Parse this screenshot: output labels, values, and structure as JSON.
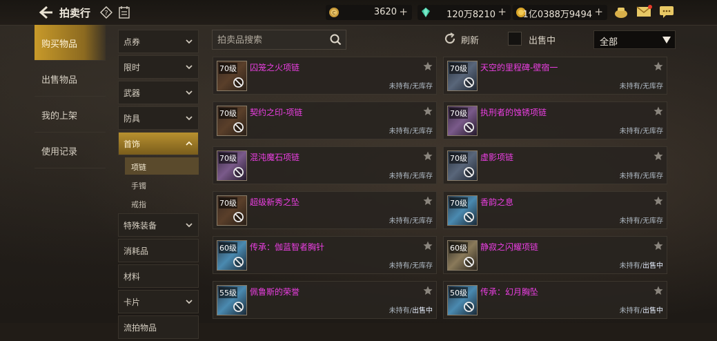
{
  "header": {
    "title": "拍卖行",
    "currencies": [
      {
        "icon": "gold-coin-icon",
        "value": "3620"
      },
      {
        "icon": "green-gem-icon",
        "value": "120万8210"
      },
      {
        "icon": "coin-icon",
        "value": "1亿0388万9494"
      }
    ],
    "plus": "+"
  },
  "nav": {
    "items": [
      {
        "label": "购买物品",
        "active": true
      },
      {
        "label": "出售物品",
        "active": false
      },
      {
        "label": "我的上架",
        "active": false
      },
      {
        "label": "使用记录",
        "active": false
      }
    ]
  },
  "categories": {
    "items": [
      {
        "label": "点券"
      },
      {
        "label": "限时"
      },
      {
        "label": "武器"
      },
      {
        "label": "防具"
      },
      {
        "label": "首饰"
      },
      {
        "label": "特殊装备"
      },
      {
        "label": "消耗品"
      },
      {
        "label": "材料"
      },
      {
        "label": "卡片"
      },
      {
        "label": "流拍物品"
      }
    ],
    "subitems": [
      {
        "label": "项链"
      },
      {
        "label": "手镯"
      },
      {
        "label": "戒指"
      }
    ]
  },
  "toolbar": {
    "search_placeholder": "拍卖品搜索",
    "refresh_label": "刷新",
    "on_sale_label": "出售中",
    "filter_value": "全部"
  },
  "items": [
    {
      "level": "70级",
      "name": "囚笼之火项链",
      "own": "未持有",
      "sep": "/",
      "stock": "无库存"
    },
    {
      "level": "70级",
      "name": "天空的里程碑-壁宿一",
      "own": "未持有",
      "sep": "/",
      "stock": "无库存"
    },
    {
      "level": "70级",
      "name": "契约之印-项链",
      "own": "未持有",
      "sep": "/",
      "stock": "无库存"
    },
    {
      "level": "70级",
      "name": "执刑者的蚀锈项链",
      "own": "未持有",
      "sep": "/",
      "stock": "无库存"
    },
    {
      "level": "70级",
      "name": "混沌魔石项链",
      "own": "未持有",
      "sep": "/",
      "stock": "无库存"
    },
    {
      "level": "70级",
      "name": "虚影项链",
      "own": "未持有",
      "sep": "/",
      "stock": "无库存"
    },
    {
      "level": "70级",
      "name": "超级新秀之坠",
      "own": "未持有",
      "sep": "/",
      "stock": "无库存"
    },
    {
      "level": "70级",
      "name": "香韵之息",
      "own": "未持有",
      "sep": "/",
      "stock": "无库存"
    },
    {
      "level": "60级",
      "name": "传承：伽蓝智者胸针",
      "own": "未持有",
      "sep": "/",
      "stock": "无库存"
    },
    {
      "level": "60级",
      "name": "静寂之闪耀项链",
      "own": "未持有",
      "sep": "/",
      "stock": "出售中"
    },
    {
      "level": "55级",
      "name": "佩鲁斯的荣誉",
      "own": "未持有",
      "sep": "/",
      "stock": "出售中"
    },
    {
      "level": "50级",
      "name": "传承：幻月胸坠",
      "own": "未持有",
      "sep": "/",
      "stock": "出售中"
    }
  ]
}
